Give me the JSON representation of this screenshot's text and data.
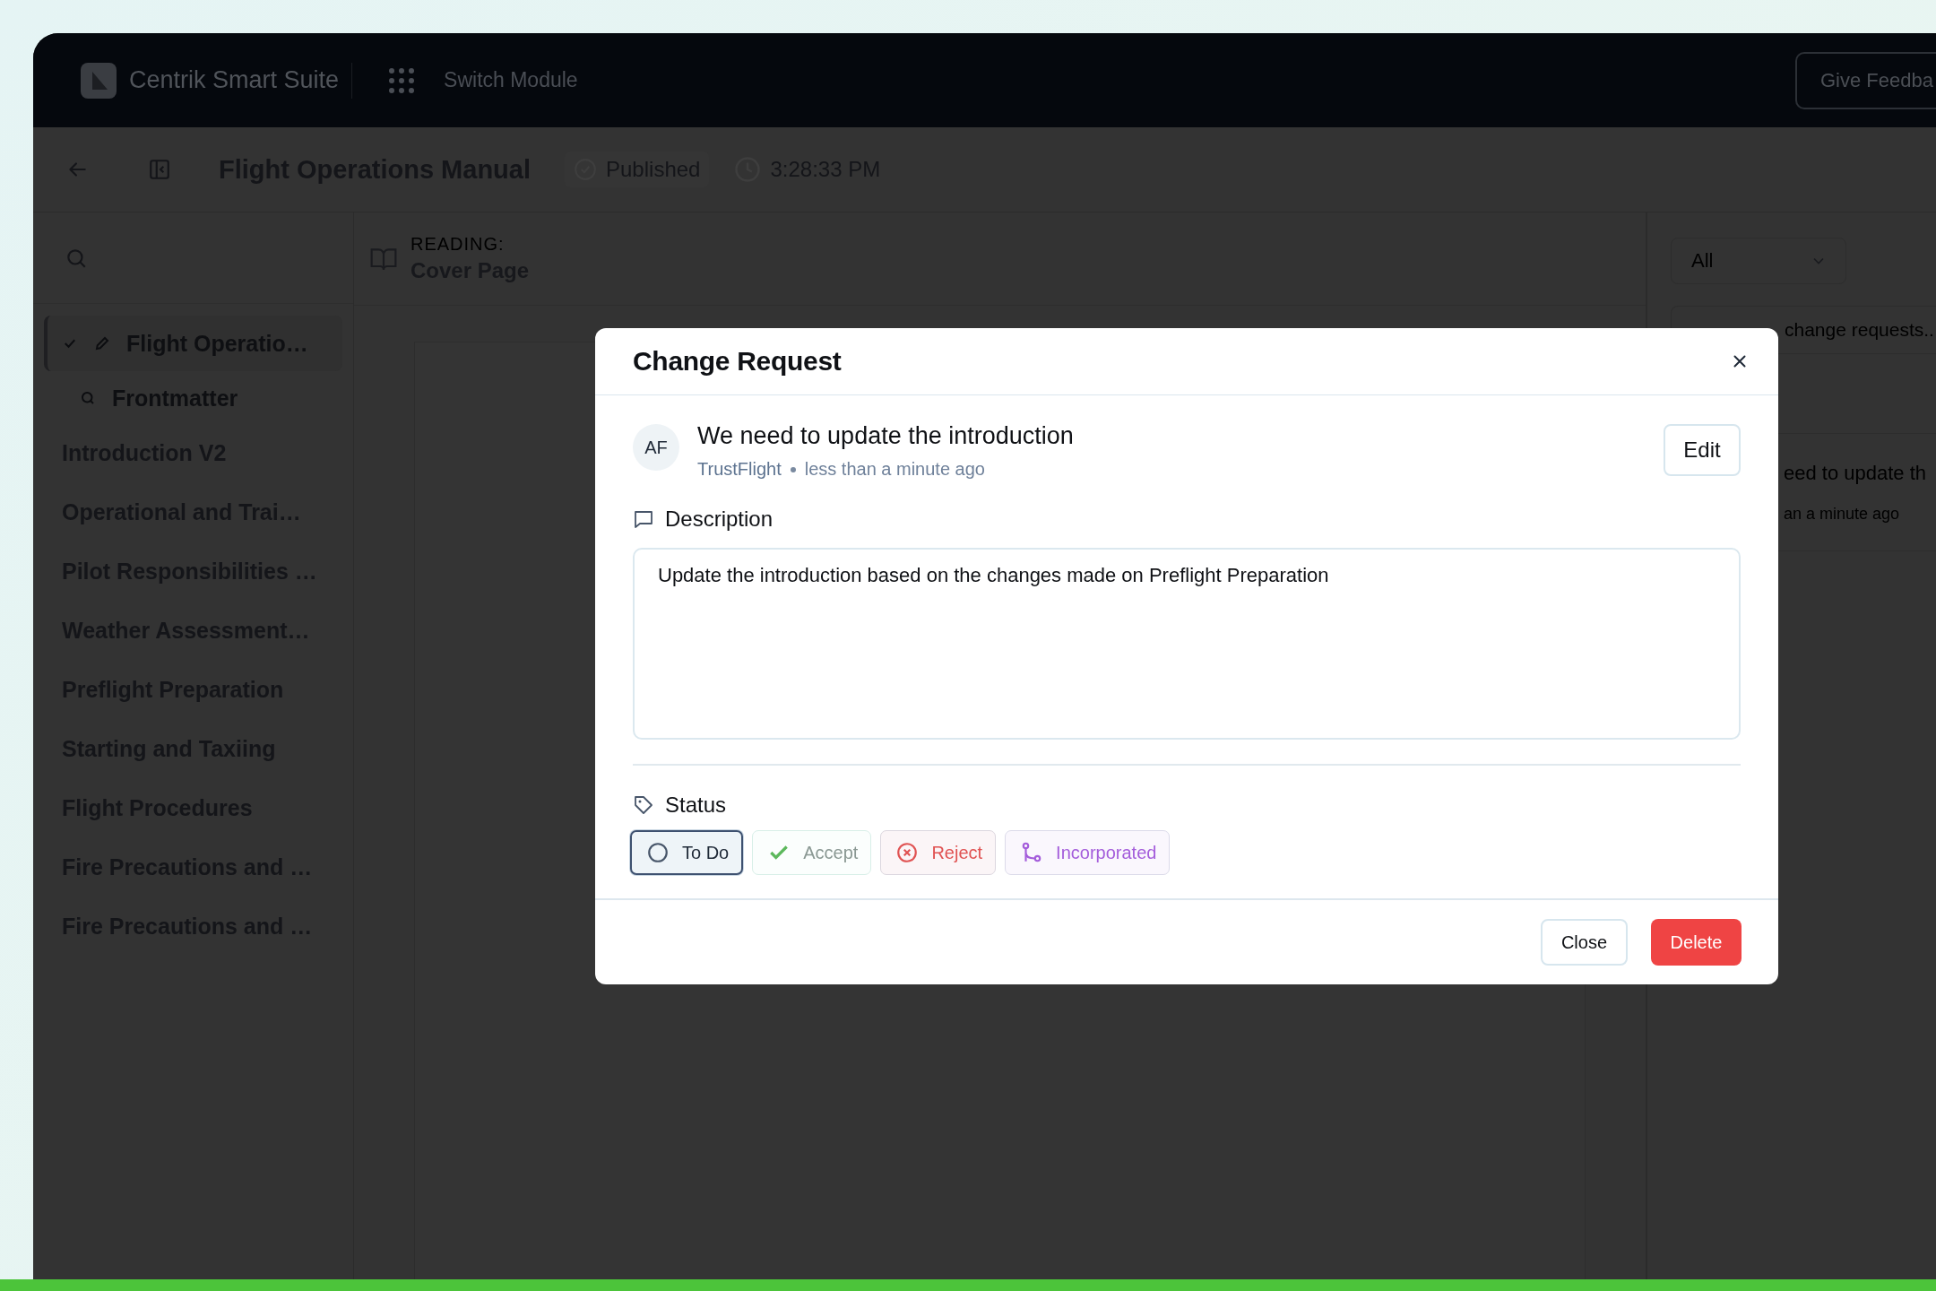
{
  "app": {
    "name": "Centrik Smart Suite",
    "switch_label": "Switch Module",
    "feedback_button": "Give Feedba"
  },
  "header": {
    "title": "Flight Operations Manual",
    "status": "Published",
    "time": "3:28:33 PM"
  },
  "sidebar": {
    "items": [
      {
        "label": "Flight Operatio…",
        "kind": "current",
        "selected": true
      },
      {
        "label": "Frontmatter",
        "kind": "child",
        "selected": false
      },
      {
        "label": "Introduction V2",
        "kind": "plain",
        "selected": false
      },
      {
        "label": "Operational and Trai…",
        "kind": "plain",
        "selected": false
      },
      {
        "label": "Pilot Responsibilities …",
        "kind": "plain",
        "selected": false
      },
      {
        "label": "Weather Assessment…",
        "kind": "plain",
        "selected": false
      },
      {
        "label": "Preflight Preparation",
        "kind": "plain",
        "selected": false
      },
      {
        "label": "Starting and Taxiing",
        "kind": "plain",
        "selected": false
      },
      {
        "label": "Flight Procedures",
        "kind": "plain",
        "selected": false
      },
      {
        "label": "Fire Precautions and …",
        "kind": "plain",
        "selected": false
      },
      {
        "label": "Fire Precautions and …",
        "kind": "plain",
        "selected": false
      }
    ]
  },
  "reader": {
    "label": "READING:",
    "section": "Cover Page"
  },
  "requests_panel": {
    "filter": "All",
    "search_placeholder": "change requests..",
    "items": [
      {
        "title": "eed to update th",
        "meta": "an a minute ago"
      }
    ]
  },
  "dialog": {
    "title": "Change Request",
    "avatar": "AF",
    "request_title": "We need to update the introduction",
    "author": "TrustFlight",
    "time": "less than a minute ago",
    "edit_button": "Edit",
    "description_label": "Description",
    "description": "Update the introduction based on the changes made on Preflight Preparation",
    "status_label": "Status",
    "statuses": [
      {
        "label": "To Do",
        "kind": "todo",
        "color": "#475569",
        "selected": true
      },
      {
        "label": "Accept",
        "kind": "accept",
        "color": "#5cb85c",
        "selected": false
      },
      {
        "label": "Reject",
        "kind": "reject",
        "color": "#e05252",
        "selected": false
      },
      {
        "label": "Incorporated",
        "kind": "incorporated",
        "color": "#a45ddb",
        "selected": false
      }
    ],
    "close_button": "Close",
    "delete_button": "Delete"
  }
}
